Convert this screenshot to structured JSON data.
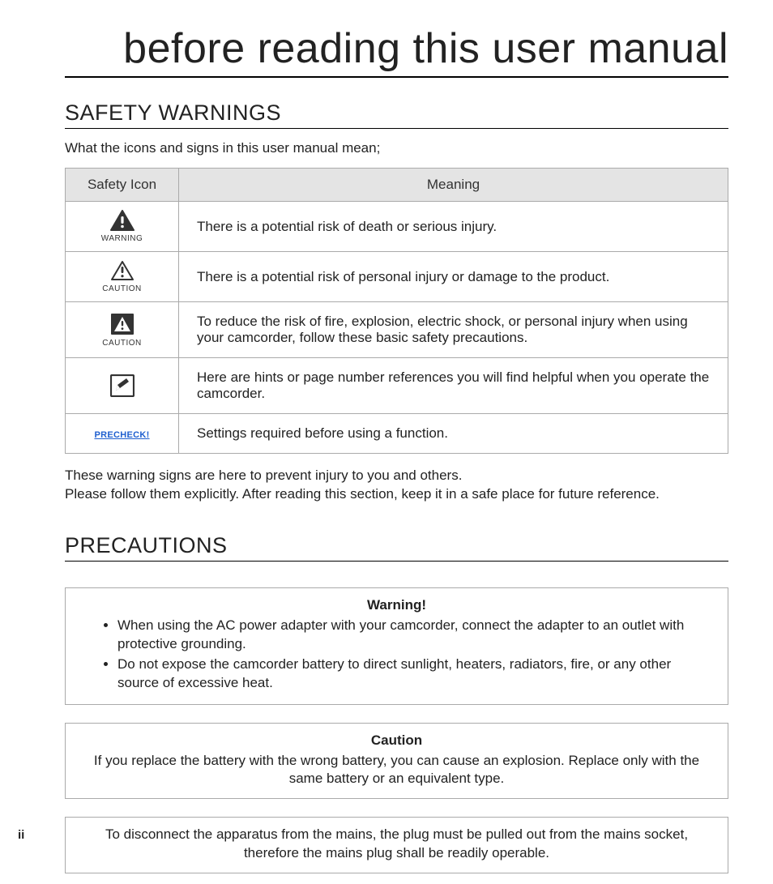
{
  "page_title": "before reading this user manual",
  "section1": {
    "heading": "SAFETY WARNINGS",
    "intro": "What the icons and signs in this user manual mean;",
    "table": {
      "head_icon": "Safety Icon",
      "head_meaning": "Meaning",
      "rows": [
        {
          "icon_name": "warning-triangle-solid-icon",
          "label": "WARNING",
          "meaning": "There is a potential risk of death or serious injury."
        },
        {
          "icon_name": "caution-triangle-outline-icon",
          "label": "CAUTION",
          "meaning": "There is a potential risk of personal injury or damage to the product."
        },
        {
          "icon_name": "caution-triangle-boxed-icon",
          "label": "CAUTION",
          "meaning": "To reduce the risk of fire, explosion, electric shock, or personal injury when using your camcorder, follow these basic safety precautions."
        },
        {
          "icon_name": "note-pencil-box-icon",
          "label": "",
          "meaning": "Here are hints or page number references you will find helpful when you operate the camcorder."
        },
        {
          "icon_name": "precheck-label",
          "label": "PRECHECK!",
          "meaning": "Settings required before using a function."
        }
      ]
    },
    "footnote_line1": "These warning signs are here to prevent injury to you and others.",
    "footnote_line2": "Please follow them explicitly. After reading this section, keep it in a safe place for future reference."
  },
  "section2": {
    "heading": "PRECAUTIONS",
    "warning_box": {
      "title": "Warning!",
      "items": [
        "When using the AC power adapter with your camcorder, connect the adapter to an outlet with protective grounding.",
        "Do not expose the camcorder battery to direct sunlight, heaters, radiators, fire, or any other source of excessive heat."
      ]
    },
    "caution_box": {
      "title": "Caution",
      "text": "If you replace the battery with the wrong battery, you can cause an explosion. Replace only with the same battery or an equivalent type."
    },
    "disconnect_box": {
      "text": "To disconnect the apparatus from the mains, the plug must be pulled out from the mains socket, therefore the mains plug shall be readily operable."
    }
  },
  "page_number": "ii"
}
